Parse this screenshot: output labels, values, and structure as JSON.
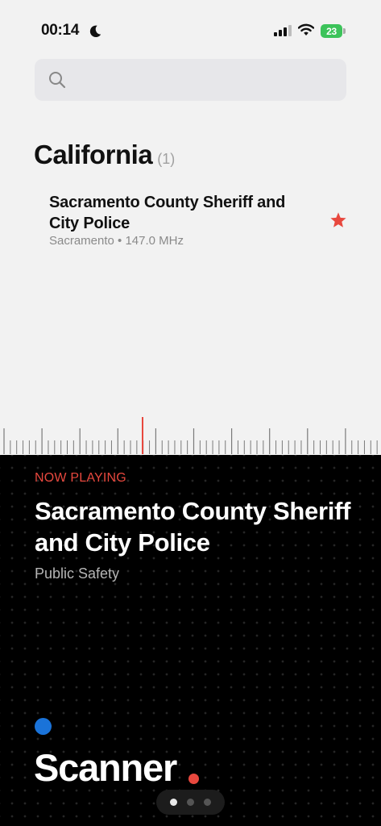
{
  "status_bar": {
    "time": "00:14",
    "battery_level": "23",
    "icons": [
      "moon-icon",
      "signal-icon",
      "wifi-icon",
      "battery-icon"
    ]
  },
  "search": {
    "placeholder": "",
    "value": ""
  },
  "section": {
    "title": "California",
    "count": "(1)"
  },
  "stations": [
    {
      "name": "Sacramento County Sheriff and City Police",
      "meta": "Sacramento • 147.0 MHz",
      "favorite": true
    }
  ],
  "player": {
    "label": "NOW PLAYING",
    "title": "Sacramento County Sheriff and City Police",
    "category": "Public Safety"
  },
  "brand": {
    "name": "Scanner"
  },
  "pager": {
    "count": 3,
    "active_index": 0
  },
  "colors": {
    "accent_red": "#e8483e",
    "accent_blue": "#1a73d9",
    "battery_green": "#3cc35a"
  }
}
